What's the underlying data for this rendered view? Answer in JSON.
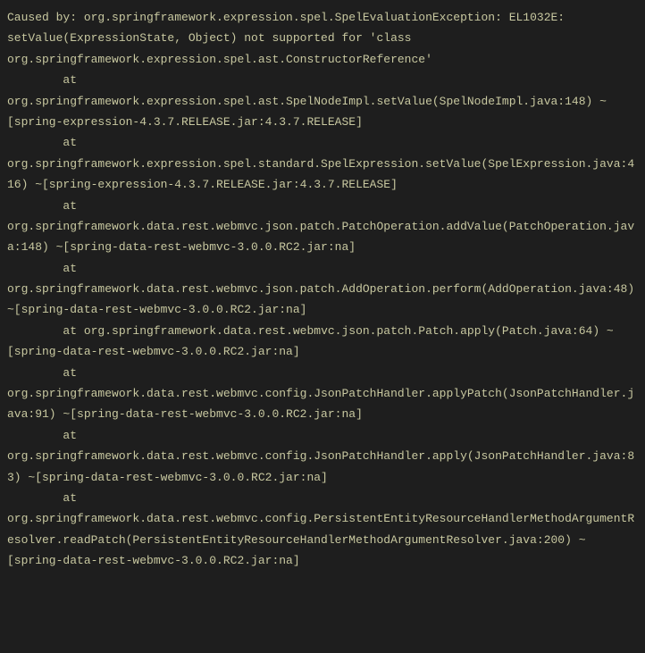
{
  "stackTrace": "Caused by: org.springframework.expression.spel.SpelEvaluationException: EL1032E: setValue(ExpressionState, Object) not supported for 'class org.springframework.expression.spel.ast.ConstructorReference'\n\tat org.springframework.expression.spel.ast.SpelNodeImpl.setValue(SpelNodeImpl.java:148) ~[spring-expression-4.3.7.RELEASE.jar:4.3.7.RELEASE]\n\tat org.springframework.expression.spel.standard.SpelExpression.setValue(SpelExpression.java:416) ~[spring-expression-4.3.7.RELEASE.jar:4.3.7.RELEASE]\n\tat org.springframework.data.rest.webmvc.json.patch.PatchOperation.addValue(PatchOperation.java:148) ~[spring-data-rest-webmvc-3.0.0.RC2.jar:na]\n\tat org.springframework.data.rest.webmvc.json.patch.AddOperation.perform(AddOperation.java:48) ~[spring-data-rest-webmvc-3.0.0.RC2.jar:na]\n\tat org.springframework.data.rest.webmvc.json.patch.Patch.apply(Patch.java:64) ~[spring-data-rest-webmvc-3.0.0.RC2.jar:na]\n\tat org.springframework.data.rest.webmvc.config.JsonPatchHandler.applyPatch(JsonPatchHandler.java:91) ~[spring-data-rest-webmvc-3.0.0.RC2.jar:na]\n\tat org.springframework.data.rest.webmvc.config.JsonPatchHandler.apply(JsonPatchHandler.java:83) ~[spring-data-rest-webmvc-3.0.0.RC2.jar:na]\n\tat org.springframework.data.rest.webmvc.config.PersistentEntityResourceHandlerMethodArgumentResolver.readPatch(PersistentEntityResourceHandlerMethodArgumentResolver.java:200) ~[spring-data-rest-webmvc-3.0.0.RC2.jar:na]"
}
